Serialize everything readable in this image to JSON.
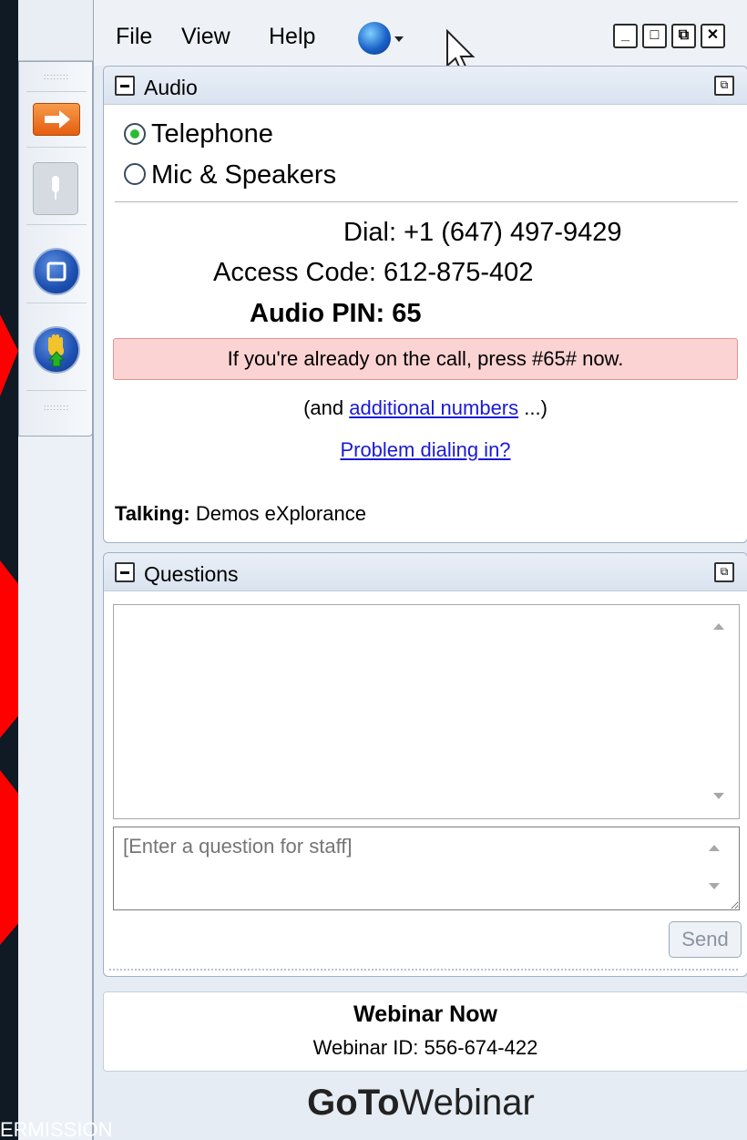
{
  "background_text": "ERMISSION",
  "menu": {
    "file": "File",
    "view": "View",
    "help": "Help"
  },
  "window_controls": {
    "minimize": "_",
    "maximize": "□",
    "restore": "⧉",
    "close": "✕"
  },
  "audio": {
    "title": "Audio",
    "option_telephone": "Telephone",
    "option_mic": "Mic & Speakers",
    "selected": "Telephone",
    "dial": "Dial: +1 (647) 497-9429",
    "access_code": "Access Code: 612-875-402",
    "audio_pin": "Audio PIN: 65",
    "notice": "If you're already on the call, press #65# now.",
    "additional_prefix": "(and ",
    "additional_link": "additional numbers",
    "additional_suffix": " ...)",
    "problem_link": "Problem dialing in?",
    "talking_label": "Talking:",
    "talking_name": "Demos eXplorance"
  },
  "questions": {
    "title": "Questions",
    "input_placeholder": "[Enter a question for staff]",
    "send": "Send"
  },
  "webinar": {
    "name": "Webinar Now",
    "id_text": "Webinar ID: 556-674-422"
  },
  "brand": {
    "goto": "GoTo",
    "webinar": "Webinar"
  },
  "colors": {
    "accent_red": "#ff0000",
    "link": "#1a1ad6",
    "notice_bg": "#fbd3d3",
    "radio_on": "#2bbb32"
  }
}
